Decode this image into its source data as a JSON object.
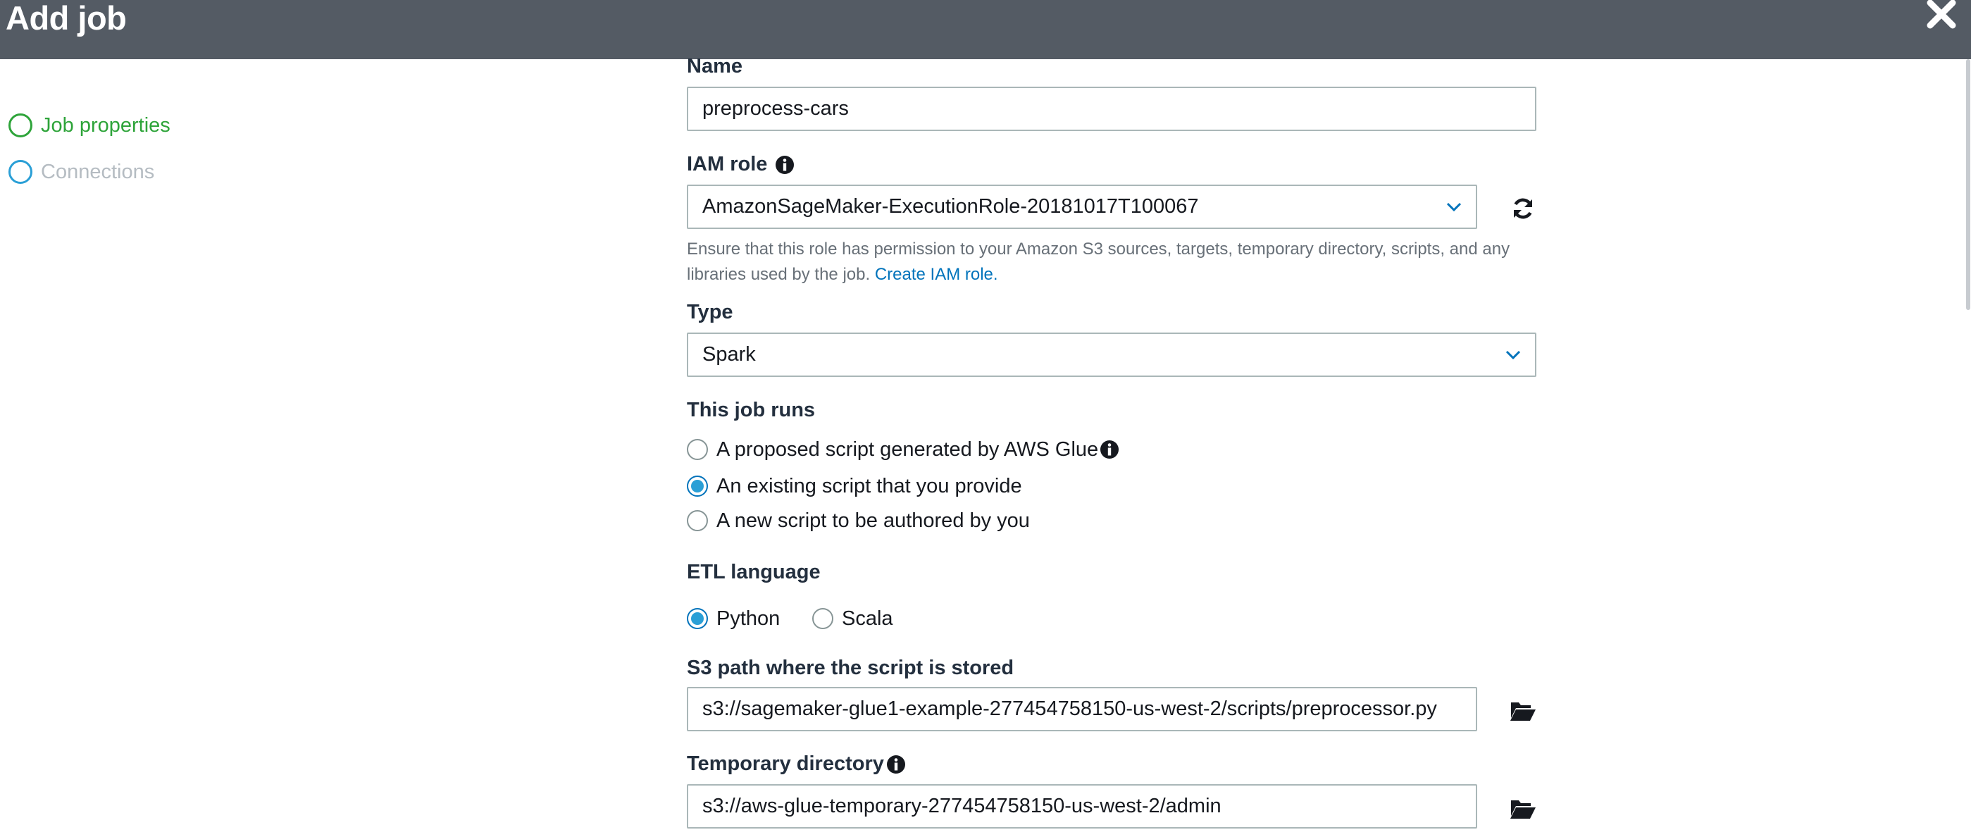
{
  "header": {
    "title": "Add job",
    "close_icon": "close-icon"
  },
  "steps": [
    {
      "label": "Job properties",
      "state": "active"
    },
    {
      "label": "Connections",
      "state": "inactive"
    }
  ],
  "form": {
    "name": {
      "label": "Name",
      "value": "preprocess-cars"
    },
    "iam_role": {
      "label": "IAM role",
      "value": "AmazonSageMaker-ExecutionRole-20181017T100067",
      "help_line1": "Ensure that this role has permission to your Amazon S3 sources, targets, temporary directory, scripts, and any",
      "help_line2": "libraries used by the job.",
      "help_link": "Create IAM role."
    },
    "type": {
      "label": "Type",
      "value": "Spark"
    },
    "job_runs": {
      "label": "This job runs",
      "options": [
        {
          "label": "A proposed script generated by AWS Glue",
          "checked": false
        },
        {
          "label": "An existing script that you provide",
          "checked": true
        },
        {
          "label": "A new script to be authored by you",
          "checked": false
        }
      ]
    },
    "etl_language": {
      "label": "ETL language",
      "options": [
        {
          "label": "Python",
          "checked": true
        },
        {
          "label": "Scala",
          "checked": false
        }
      ]
    },
    "script_path": {
      "label": "S3 path where the script is stored",
      "value": "s3://sagemaker-glue1-example-277454758150-us-west-2/scripts/preprocessor.py"
    },
    "temp_dir": {
      "label": "Temporary directory",
      "value": "s3://aws-glue-temporary-277454758150-us-west-2/admin"
    }
  },
  "colors": {
    "header_bg": "#545b64",
    "active_step": "#2ea43a",
    "link": "#0073bb",
    "radio_selected": "#2a9fd6"
  }
}
